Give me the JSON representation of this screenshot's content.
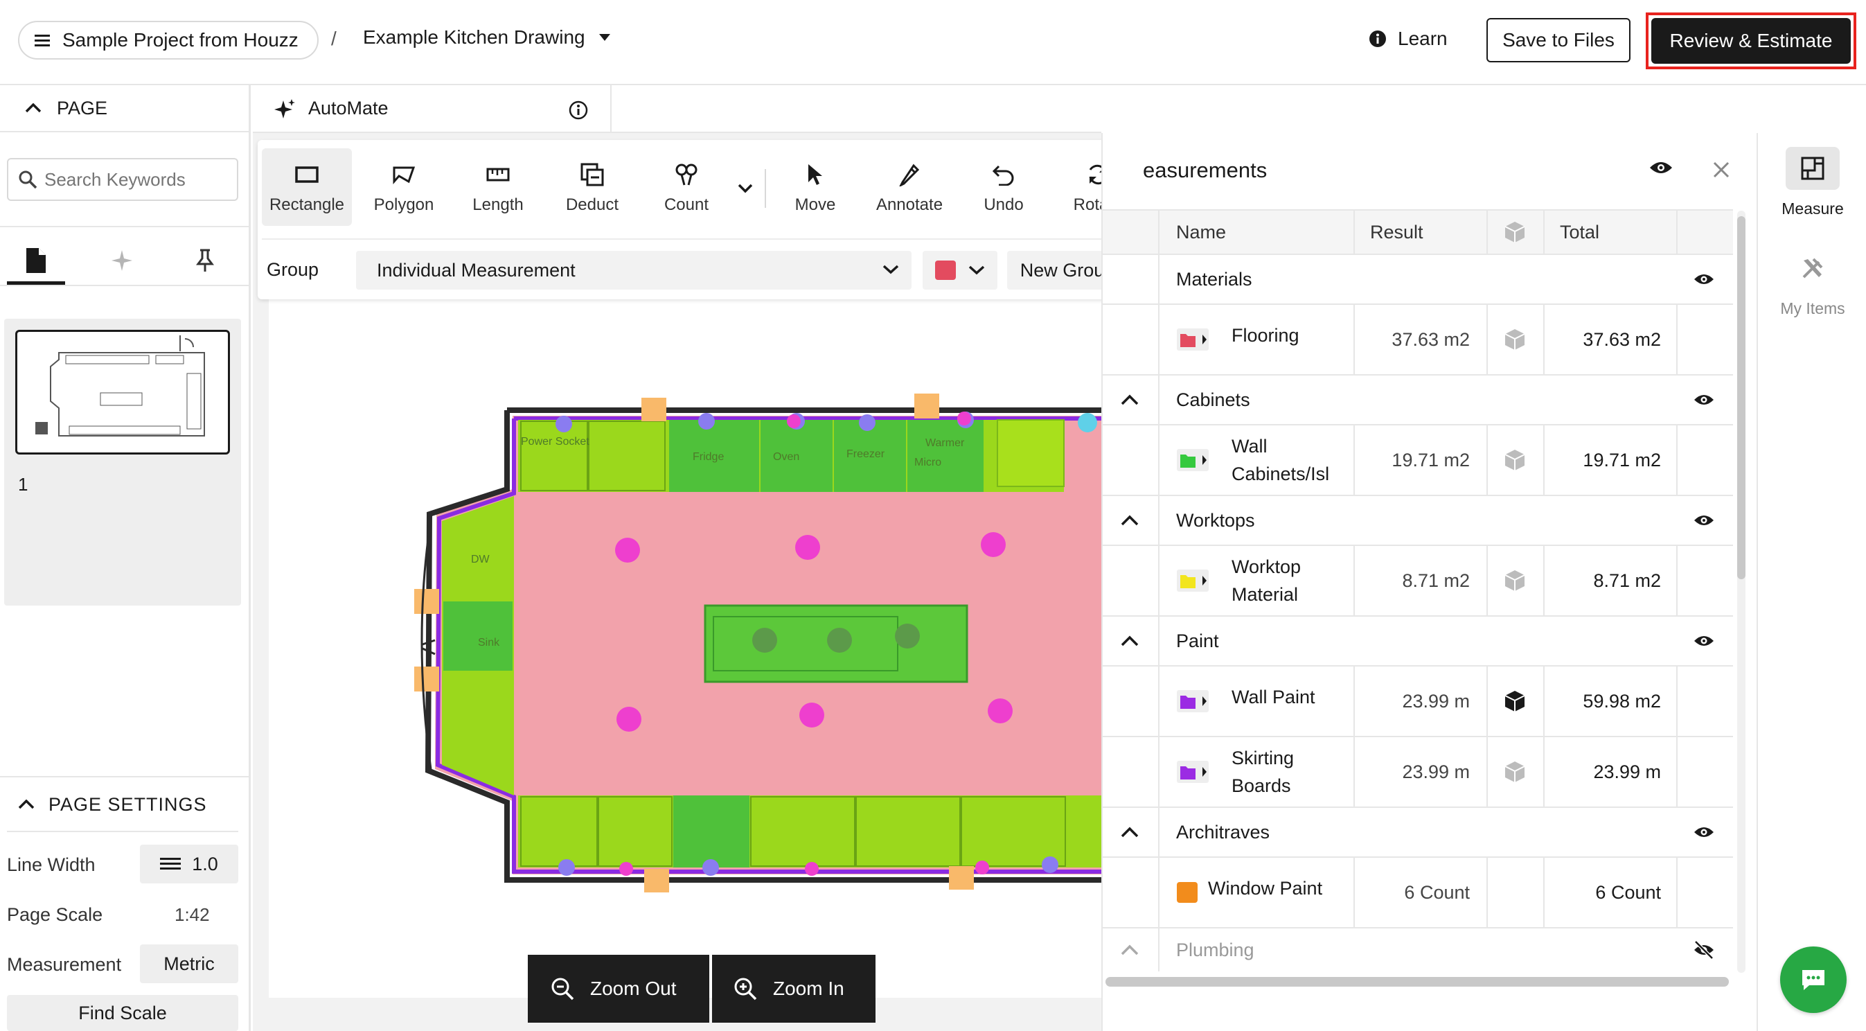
{
  "header": {
    "project_label": "Sample Project from Houzz",
    "separator": "/",
    "drawing_label": "Example Kitchen Drawing",
    "learn_label": "Learn",
    "save_label": "Save to Files",
    "review_label": "Review & Estimate"
  },
  "left_panel": {
    "page_section_title": "PAGE",
    "search_placeholder": "Search Keywords",
    "page_number": "1",
    "page_settings_title": "PAGE SETTINGS",
    "line_width_label": "Line Width",
    "line_width_value": "1.0",
    "page_scale_label": "Page Scale",
    "page_scale_value": "1:42",
    "measurement_label": "Measurement",
    "measurement_value": "Metric",
    "find_scale_label": "Find Scale"
  },
  "automate": {
    "label": "AutoMate"
  },
  "toolbar": {
    "tools": [
      "Rectangle",
      "Polygon",
      "Length",
      "Deduct",
      "Count",
      "Move",
      "Annotate",
      "Undo",
      "Rotate"
    ],
    "group_label": "Group",
    "group_value": "Individual Measurement",
    "group_color": "#e34b5f",
    "new_group_label": "New Group"
  },
  "zoom": {
    "out_label": "Zoom Out",
    "in_label": "Zoom In"
  },
  "drawing_labels": {
    "fridge": "Fridge",
    "oven": "Oven",
    "freezer": "Freezer",
    "warmer": "Warmer",
    "micro": "Micro",
    "power_socket": "Power Socket",
    "dw": "DW",
    "sink": "Sink"
  },
  "measurements": {
    "title": "easurements",
    "columns": {
      "name": "Name",
      "result": "Result",
      "total": "Total"
    },
    "groups": [
      {
        "name": "Materials",
        "visible": true,
        "items": [
          {
            "name": "Flooring",
            "result": "37.63 m2",
            "total": "37.63 m2",
            "color": "#e34b5f",
            "icon": "folder-icon",
            "cube_dark": false
          }
        ]
      },
      {
        "name": "Cabinets",
        "visible": true,
        "items": [
          {
            "name": "Wall Cabinets/Isl",
            "result": "19.71 m2",
            "total": "19.71 m2",
            "color": "#35c93e",
            "icon": "folder-icon",
            "cube_dark": false
          }
        ]
      },
      {
        "name": "Worktops",
        "visible": true,
        "items": [
          {
            "name": "Worktop Material",
            "result": "8.71 m2",
            "total": "8.71 m2",
            "color": "#f2e51d",
            "icon": "folder-icon",
            "cube_dark": false
          }
        ]
      },
      {
        "name": "Paint",
        "visible": true,
        "items": [
          {
            "name": "Wall Paint",
            "result": "23.99 m",
            "total": "59.98 m2",
            "color": "#9b2be3",
            "icon": "folder-icon",
            "cube_dark": true
          },
          {
            "name": "Skirting Boards",
            "result": "23.99 m",
            "total": "23.99 m",
            "color": "#9b2be3",
            "icon": "folder-icon",
            "cube_dark": false
          }
        ]
      },
      {
        "name": "Architraves",
        "visible": true,
        "items": [
          {
            "name": "Window Paint",
            "result": "6 Count",
            "total": "6 Count",
            "color": "#f28c1c",
            "icon": "square-icon",
            "cube_dark": false
          }
        ]
      },
      {
        "name": "Plumbing",
        "visible": false,
        "items": []
      }
    ]
  },
  "rail": {
    "measure_label": "Measure",
    "my_items_label": "My Items"
  }
}
